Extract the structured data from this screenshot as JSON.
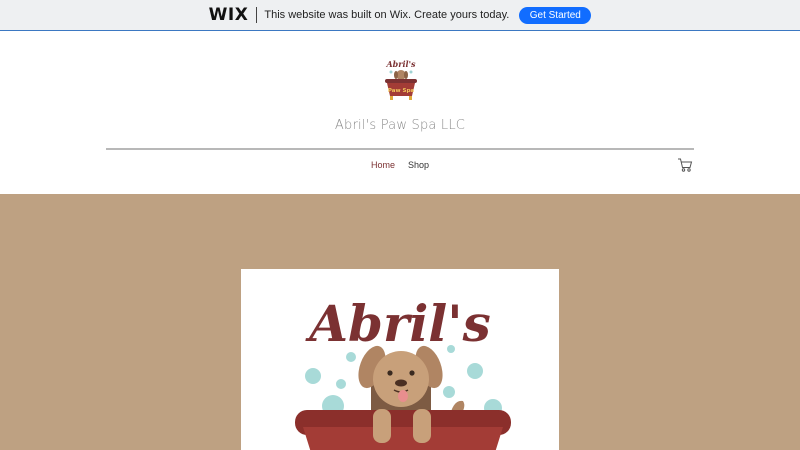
{
  "wix_banner": {
    "logo": "WIX",
    "message": "This website was built on Wix. Create yours today.",
    "cta_label": "Get Started"
  },
  "header": {
    "logo_text_top": "Abril's",
    "logo_text_bottom": "Paw Spa",
    "site_title": "Abril's Paw Spa LLC"
  },
  "nav": {
    "items": [
      {
        "label": "Home",
        "active": true
      },
      {
        "label": "Shop",
        "active": false
      }
    ],
    "cart_icon": "cart-icon"
  },
  "hero": {
    "background_color": "#bea182",
    "logo_text": "Abril's"
  },
  "colors": {
    "brand": "#7b3132",
    "cta": "#116dff"
  }
}
